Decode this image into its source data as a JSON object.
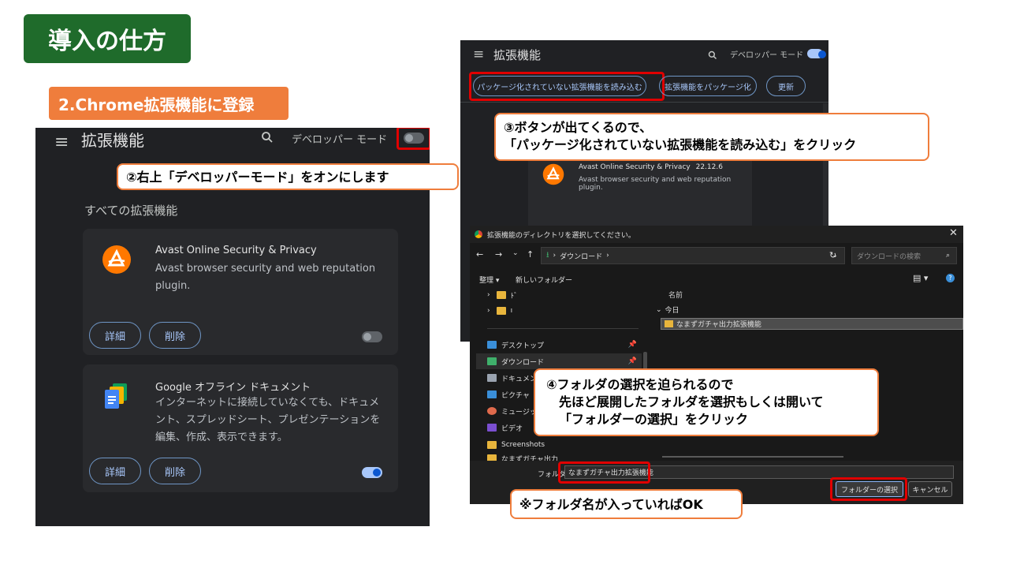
{
  "slide": {
    "title": "導入の仕方",
    "step_heading": "2.Chrome拡張機能に登録"
  },
  "left_panel": {
    "menu_icon": "menu-icon",
    "title": "拡張機能",
    "search_icon": "search-icon",
    "dev_mode_label": "デベロッパー モード",
    "dev_mode_on": false,
    "section_title": "すべての拡張機能",
    "extensions": [
      {
        "name": "Avast Online Security & Privacy",
        "description": "Avast browser security and web reputation plugin.",
        "details_label": "詳細",
        "remove_label": "削除",
        "enabled": false,
        "icon": "avast-logo-icon"
      },
      {
        "name": "Google オフライン ドキュメント",
        "description": "インターネットに接続していなくても、ドキュメント、スプレッドシート、プレゼンテーションを編集、作成、表示できます。",
        "details_label": "詳細",
        "remove_label": "削除",
        "enabled": true,
        "icon": "google-docs-icon"
      }
    ]
  },
  "callouts": {
    "step2": "②右上「デベロッパーモード」をオンにします",
    "step3_line1": "③ボタンが出てくるので、",
    "step3_line2": "「パッケージ化されていない拡張機能を読み込む」をクリック",
    "step4_line1": "④フォルダの選択を迫られるので",
    "step4_line2": "先ほど展開したフォルダを選択もしくは開いて",
    "step4_line3": "「フォルダーの選択」をクリック",
    "note": "※フォルダ名が入っていればOK"
  },
  "top_right_panel": {
    "title": "拡張機能",
    "dev_mode_label": "デベロッパー モード",
    "dev_mode_on": true,
    "buttons": [
      "パッケージ化されていない拡張機能を読み込む",
      "拡張機能をパッケージ化",
      "更新"
    ],
    "extension_name": "Avast Online Security & Privacy",
    "extension_version": "22.12.6",
    "extension_description": "Avast browser security and web reputation plugin."
  },
  "dialog": {
    "title": "拡張機能のディレクトリを選択してください。",
    "breadcrumb": [
      "ダウンロード"
    ],
    "search_placeholder": "ダウンロードの検索",
    "organize_label": "整理 ▾",
    "new_folder_label": "新しいフォルダー",
    "column_name": "名前",
    "group_today": "今日",
    "selected_folder": "なまずガチャ出力拡張機能",
    "sidebar_items": [
      {
        "label": "デスクトップ",
        "color": "#3a8fd9"
      },
      {
        "label": "ダウンロード",
        "color": "#3fb06b"
      },
      {
        "label": "ドキュメント",
        "color": "#9aa3b0"
      },
      {
        "label": "ピクチャ",
        "color": "#3a8fd9"
      },
      {
        "label": "ミュージック",
        "color": "#e06a4c"
      },
      {
        "label": "ビデオ",
        "color": "#7b4fd0"
      },
      {
        "label": "Screenshots",
        "color": "#e8b53c"
      },
      {
        "label": "なまずガチャ出力",
        "color": "#e8b53c"
      }
    ],
    "tree_item_1": "ﾄﾞ",
    "folder_label": "フォルダー:",
    "folder_value": "なまずガチャ出力拡張機能",
    "select_button": "フォルダーの選択",
    "cancel_button": "キャンセル"
  },
  "colors": {
    "title_bg": "#1f6b2b",
    "step_bg": "#ef7d3c",
    "callout_border": "#ef7d3c",
    "highlight_red": "#e00000",
    "chrome_bg": "#202124",
    "accent_blue": "#a8c7fa"
  }
}
